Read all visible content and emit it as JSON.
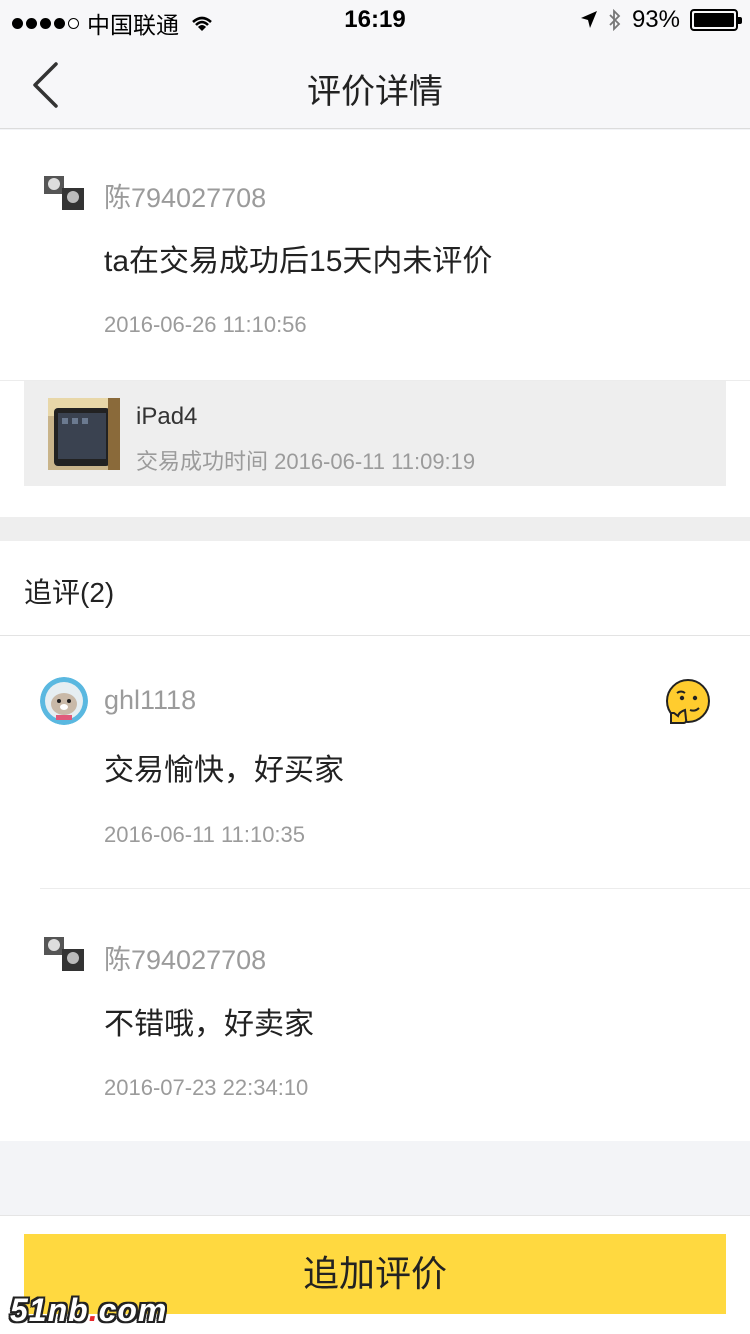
{
  "status_bar": {
    "carrier": "中国联通",
    "time": "16:19",
    "battery": "93%"
  },
  "nav": {
    "title": "评价详情"
  },
  "review": {
    "username": "陈794027708",
    "content": "ta在交易成功后15天内未评价",
    "time": "2016-06-26 11:10:56"
  },
  "item": {
    "name": "iPad4",
    "trade_time": "交易成功时间 2016-06-11 11:09:19"
  },
  "followups": {
    "header": "追评(2)",
    "entries": [
      {
        "username": "ghl1118",
        "content": "交易愉快，好买家",
        "time": "2016-06-11 11:10:35",
        "icon": "thinking-emoji-icon"
      },
      {
        "username": "陈794027708",
        "content": "不错哦，好卖家",
        "time": "2016-07-23 22:34:10"
      }
    ]
  },
  "actions": {
    "add_review": "追加评价"
  },
  "watermark": {
    "text_a": "51nb",
    "text_b": ".",
    "text_c": "com"
  },
  "colors": {
    "accent": "#ffd940",
    "secondary_text": "#9b9b9b",
    "background": "#f3f4f7"
  }
}
